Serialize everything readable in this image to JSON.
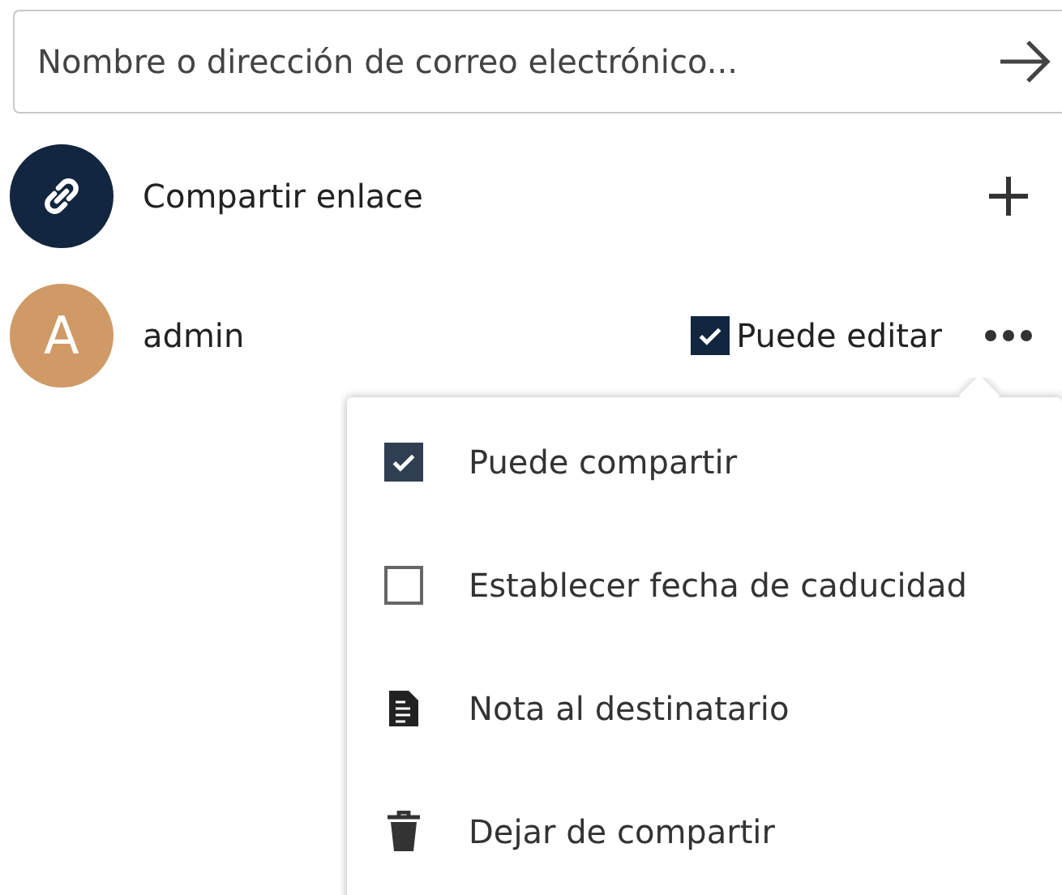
{
  "search": {
    "placeholder": "Nombre o dirección de correo electrónico..."
  },
  "shares": [
    {
      "kind": "link",
      "label": "Compartir enlace"
    },
    {
      "kind": "user",
      "avatar_letter": "A",
      "color": "#d09a67",
      "label": "admin",
      "permission": {
        "label": "Puede editar",
        "checked": true
      }
    }
  ],
  "menu": {
    "items": [
      {
        "kind": "checkbox",
        "label": "Puede compartir",
        "checked": true
      },
      {
        "kind": "checkbox",
        "label": "Establecer fecha de caducidad",
        "checked": false
      },
      {
        "kind": "note",
        "label": "Nota al destinatario"
      },
      {
        "kind": "delete",
        "label": "Dejar de compartir"
      }
    ]
  }
}
